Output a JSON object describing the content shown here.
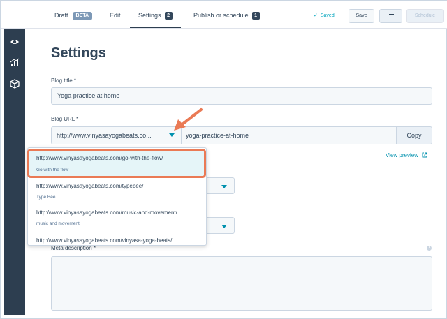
{
  "topbar": {
    "tabs": [
      {
        "label": "Draft",
        "badge": "BETA"
      },
      {
        "label": "Edit"
      },
      {
        "label": "Settings",
        "badge": "2"
      },
      {
        "label": "Publish or schedule",
        "badge": "1"
      }
    ],
    "saved_label": "Saved",
    "save_label": "Save",
    "schedule_label": "Schedule"
  },
  "sidebar": {
    "icons": [
      "eye-icon",
      "chart-icon",
      "cube-icon"
    ]
  },
  "main": {
    "title": "Settings",
    "blog_title_label": "Blog title *",
    "blog_title_value": "Yoga practice at home",
    "blog_url_label": "Blog URL *",
    "url_domain": "http://www.vinyasayogabeats.co...",
    "url_slug": "yoga-practice-at-home",
    "copy_label": "Copy",
    "view_preview_label": "View preview",
    "meta_description_label": "Meta description *"
  },
  "dropdown": {
    "options": [
      {
        "url": "http://www.vinyasayogabeats.com/go-with-the-flow/",
        "name": "Go with the flow",
        "highlighted": true
      },
      {
        "url": "http://www.vinyasayogabeats.com/typebee/",
        "name": "Type Bee"
      },
      {
        "url": "http://www.vinyasayogabeats.com/music-and-movement/",
        "name": "music and movement"
      },
      {
        "url": "http://www.vinyasayogabeats.com/vinyasa-yoga-beats/",
        "name": ""
      }
    ]
  },
  "colors": {
    "accent": "#0091ae",
    "rail": "#2d3e50",
    "highlight_border": "#ea7a55",
    "highlight_bg": "#e5f5f8"
  }
}
